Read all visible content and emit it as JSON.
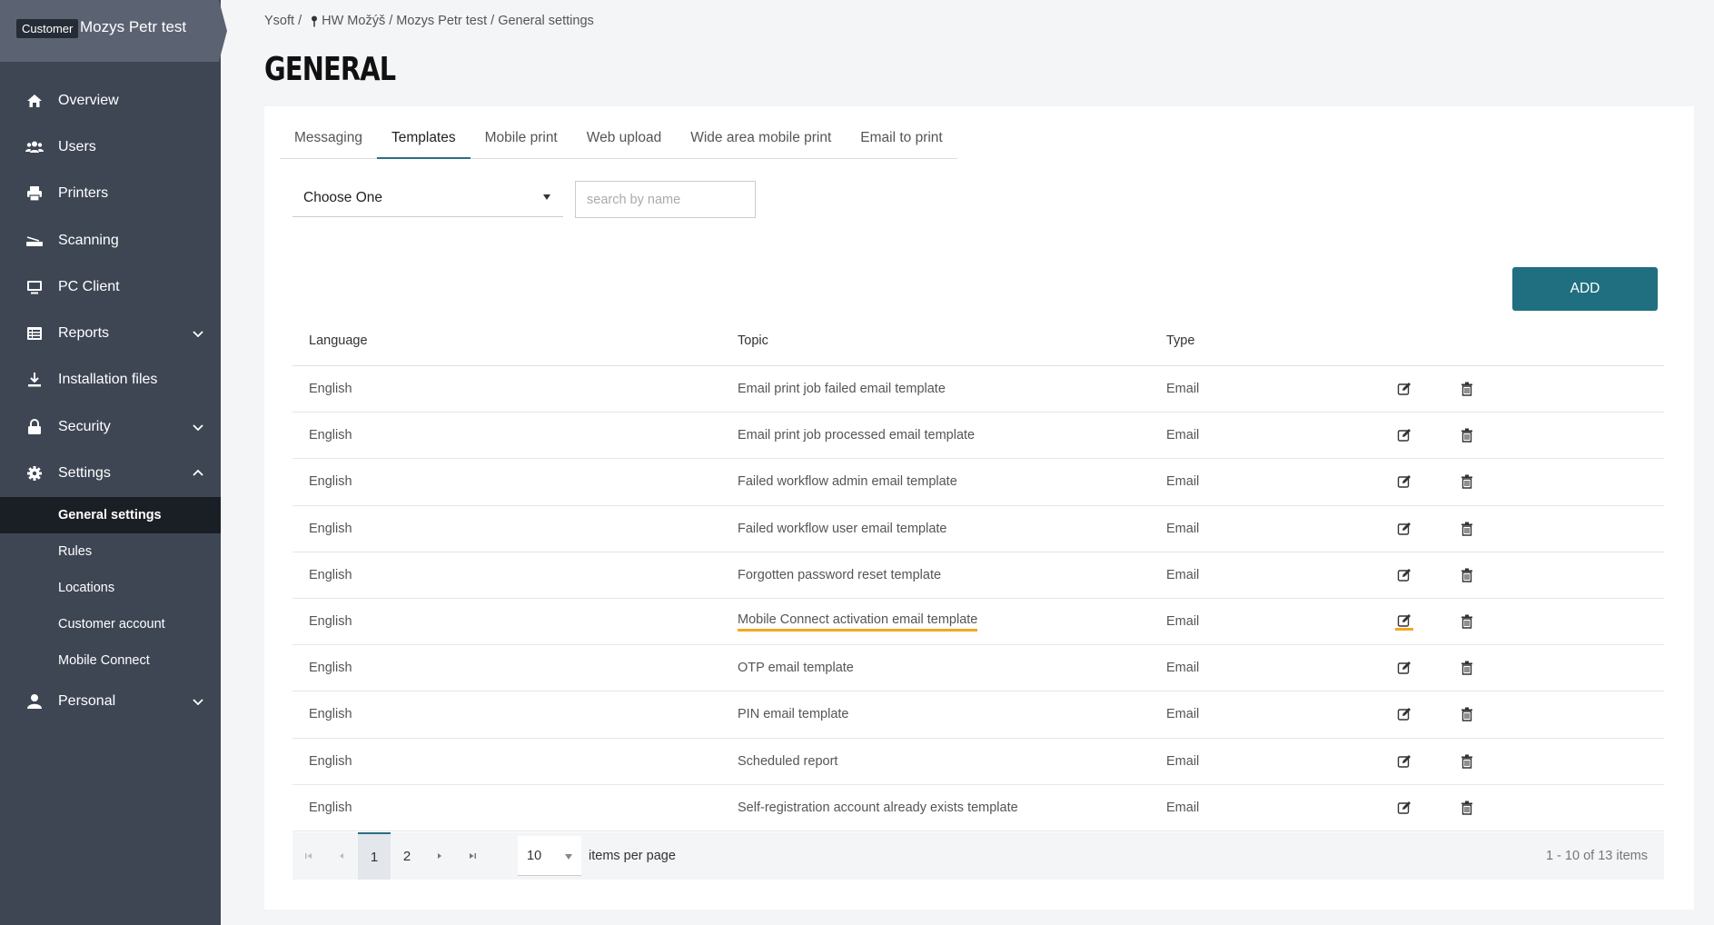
{
  "customer": {
    "badge": "Customer",
    "name": "Mozys Petr test"
  },
  "nav": [
    {
      "label": "Overview",
      "icon": "home-icon"
    },
    {
      "label": "Users",
      "icon": "users-icon"
    },
    {
      "label": "Printers",
      "icon": "printer-icon"
    },
    {
      "label": "Scanning",
      "icon": "scanner-icon"
    },
    {
      "label": "PC Client",
      "icon": "monitor-icon"
    },
    {
      "label": "Reports",
      "icon": "reports-icon"
    },
    {
      "label": "Installation files",
      "icon": "download-icon"
    },
    {
      "label": "Security",
      "icon": "lock-icon"
    },
    {
      "label": "Settings",
      "icon": "gear-icon"
    },
    {
      "label": "Personal",
      "icon": "person-icon"
    }
  ],
  "settings_sub": [
    "General settings",
    "Rules",
    "Locations",
    "Customer account",
    "Mobile Connect"
  ],
  "breadcrumb": {
    "root": "Ysoft /",
    "org": "HW Možýš",
    "sep1": "/",
    "customer": "Mozys Petr test",
    "sep2": "/",
    "current": "General settings"
  },
  "page_title": "GENERAL",
  "tabs": [
    "Messaging",
    "Templates",
    "Mobile print",
    "Web upload",
    "Wide area mobile print",
    "Email to print"
  ],
  "filter": {
    "select_value": "Choose One",
    "search_placeholder": "search by name"
  },
  "add_label": "ADD",
  "table": {
    "headers": {
      "language": "Language",
      "topic": "Topic",
      "type": "Type"
    },
    "rows": [
      {
        "language": "English",
        "topic": "Email print job failed email template",
        "type": "Email"
      },
      {
        "language": "English",
        "topic": "Email print job processed email template",
        "type": "Email"
      },
      {
        "language": "English",
        "topic": "Failed workflow admin email template",
        "type": "Email"
      },
      {
        "language": "English",
        "topic": "Failed workflow user email template",
        "type": "Email"
      },
      {
        "language": "English",
        "topic": "Forgotten password reset template",
        "type": "Email"
      },
      {
        "language": "English",
        "topic": "Mobile Connect activation email template",
        "type": "Email"
      },
      {
        "language": "English",
        "topic": "OTP email template",
        "type": "Email"
      },
      {
        "language": "English",
        "topic": "PIN email template",
        "type": "Email"
      },
      {
        "language": "English",
        "topic": "Scheduled report",
        "type": "Email"
      },
      {
        "language": "English",
        "topic": "Self-registration account already exists template",
        "type": "Email"
      }
    ]
  },
  "pager": {
    "pages": [
      "1",
      "2"
    ],
    "per_page": "10",
    "per_page_label": "items per page",
    "summary": "1 - 10 of 13 items"
  },
  "colors": {
    "sidebar": "#3e4654",
    "accent": "#1f6f80",
    "highlight": "#f5a623"
  }
}
